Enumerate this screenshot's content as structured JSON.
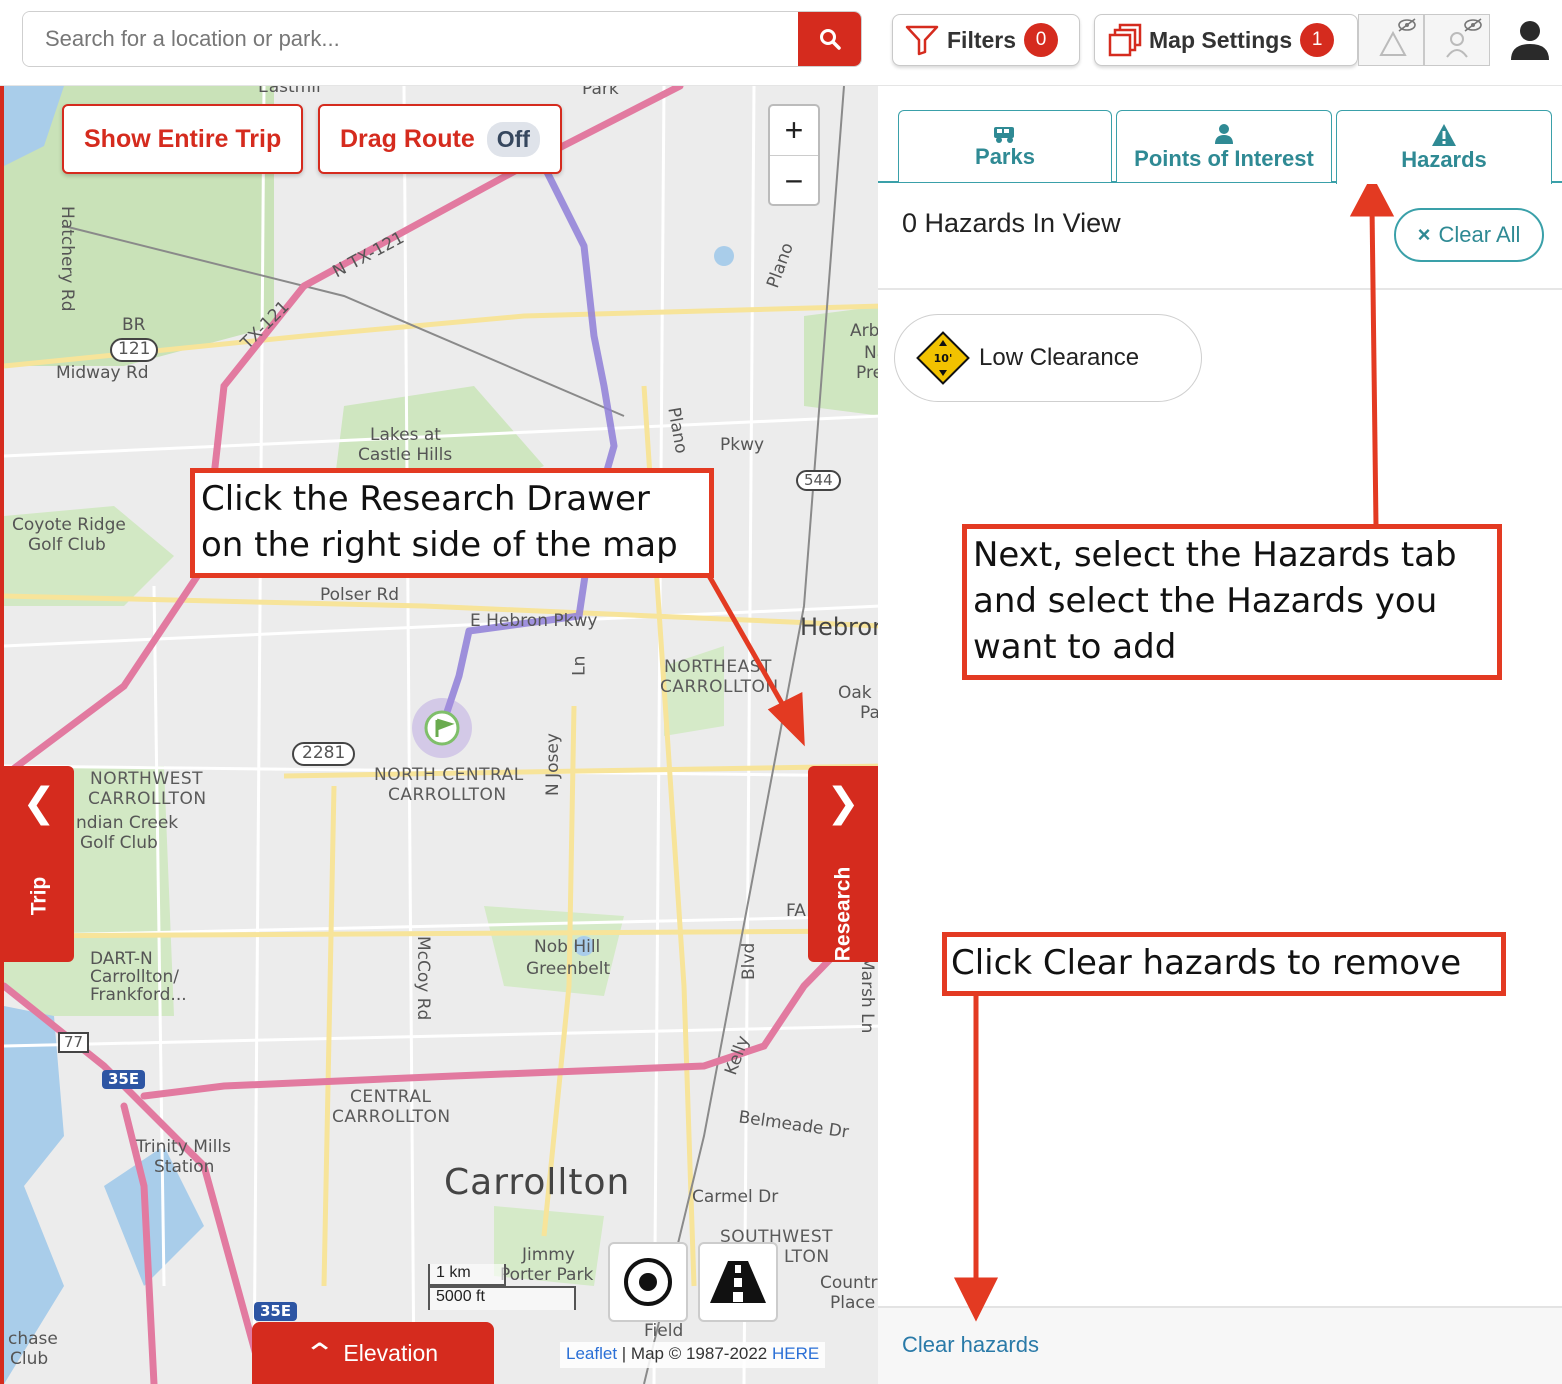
{
  "search": {
    "placeholder": "Search for a location or park..."
  },
  "toolbar": {
    "filters_label": "Filters",
    "filters_count": "0",
    "map_settings_label": "Map Settings",
    "map_settings_count": "1"
  },
  "map": {
    "show_entire_trip": "Show Entire Trip",
    "drag_route": "Drag Route",
    "drag_route_state": "Off",
    "zoom_in": "+",
    "zoom_out": "−",
    "trip_drawer": "Trip",
    "research_drawer": "Research",
    "elevation": "Elevation",
    "scale_km": "1 km",
    "scale_ft": "5000 ft",
    "attribution": {
      "leaflet": "Leaflet",
      "map_text": "| Map © 1987-2022",
      "here": "HERE"
    },
    "labels": {
      "eastmil": "Eastmil",
      "park": "Park",
      "hatchery": "Hatchery Rd",
      "tx121_a": "N TX-121",
      "tx121_b": "TX-121",
      "br": "BR",
      "r121": "121",
      "midway": "Midway Rd",
      "lakes": "Lakes at",
      "castle": "Castle Hills",
      "plano_a": "Plano",
      "plano_b": "Plano",
      "pkwy": "Pkwy",
      "r544": "544",
      "arbor": "Arbo",
      "na": "Na",
      "pre": "Pre",
      "coyote": "Coyote Ridge",
      "golfclub": "Golf Club",
      "polser": "Polser Rd",
      "hebron_e": "E Hebron Pkwy",
      "hebron": "Hebron",
      "ln": "Ln",
      "northeast": "NORTHEAST",
      "ne_carrollton": "CARROLLTON",
      "oak": "Oak C",
      "pa": "Pa",
      "r2281": "2281",
      "nc": "NORTH CENTRAL",
      "nc_carrollton": "CARROLLTON",
      "josey": "N Josey",
      "nw": "NORTHWEST",
      "nw_carrollton": "CARROLLTON",
      "indian": "ndian Creek",
      "indian_golf": "Golf Club",
      "dart": "DART-N",
      "dart2": "Carrollton/",
      "dart3": "Frankford...",
      "r77": "77",
      "r35e": "35E",
      "mccoy": "McCoy Rd",
      "nob": "Nob Hill",
      "greenbelt": "Greenbelt",
      "blvd": "Blvd",
      "kelly": "Kelly",
      "marsh": "Marsh Ln",
      "fa": "FA",
      "central": "CENTRAL",
      "central_c": "CARROLLTON",
      "belmeade": "Belmeade Dr",
      "trinity": "Trinity Mills",
      "station": "Station",
      "carrollton": "Carrollton",
      "carmel": "Carmel Dr",
      "southwest": "SOUTHWEST",
      "lton": "LTON",
      "jimmy": "Jimmy",
      "porter": "Porter Park",
      "country": "Country",
      "place": "Place",
      "field": "Field",
      "chase": "chase",
      "club": "Club",
      "r35e_b": "35E"
    }
  },
  "callouts": {
    "research": "Click the Research Drawer on the right side of the map",
    "hazards_tab": "Next, select the Hazards tab and select the Hazards you want to add",
    "clear": "Click Clear hazards to remove"
  },
  "panel": {
    "tabs": [
      {
        "label": "Parks",
        "icon": "rv-icon"
      },
      {
        "label": "Points of Interest",
        "icon": "person-pin-icon"
      },
      {
        "label": "Hazards",
        "icon": "warning-icon"
      }
    ],
    "hazards_count": "0 Hazards In View",
    "clear_all": "Clear All",
    "clear_all_icon": "×",
    "hazard_items": [
      {
        "label": "Low Clearance",
        "sign": "10'"
      }
    ],
    "clear_hazards": "Clear hazards"
  },
  "colors": {
    "brand_red": "#d52b1e",
    "teal": "#3aa0a9",
    "route": "#8f7fd8",
    "highway": "#e27aa0",
    "annotation": "#e33a22"
  }
}
